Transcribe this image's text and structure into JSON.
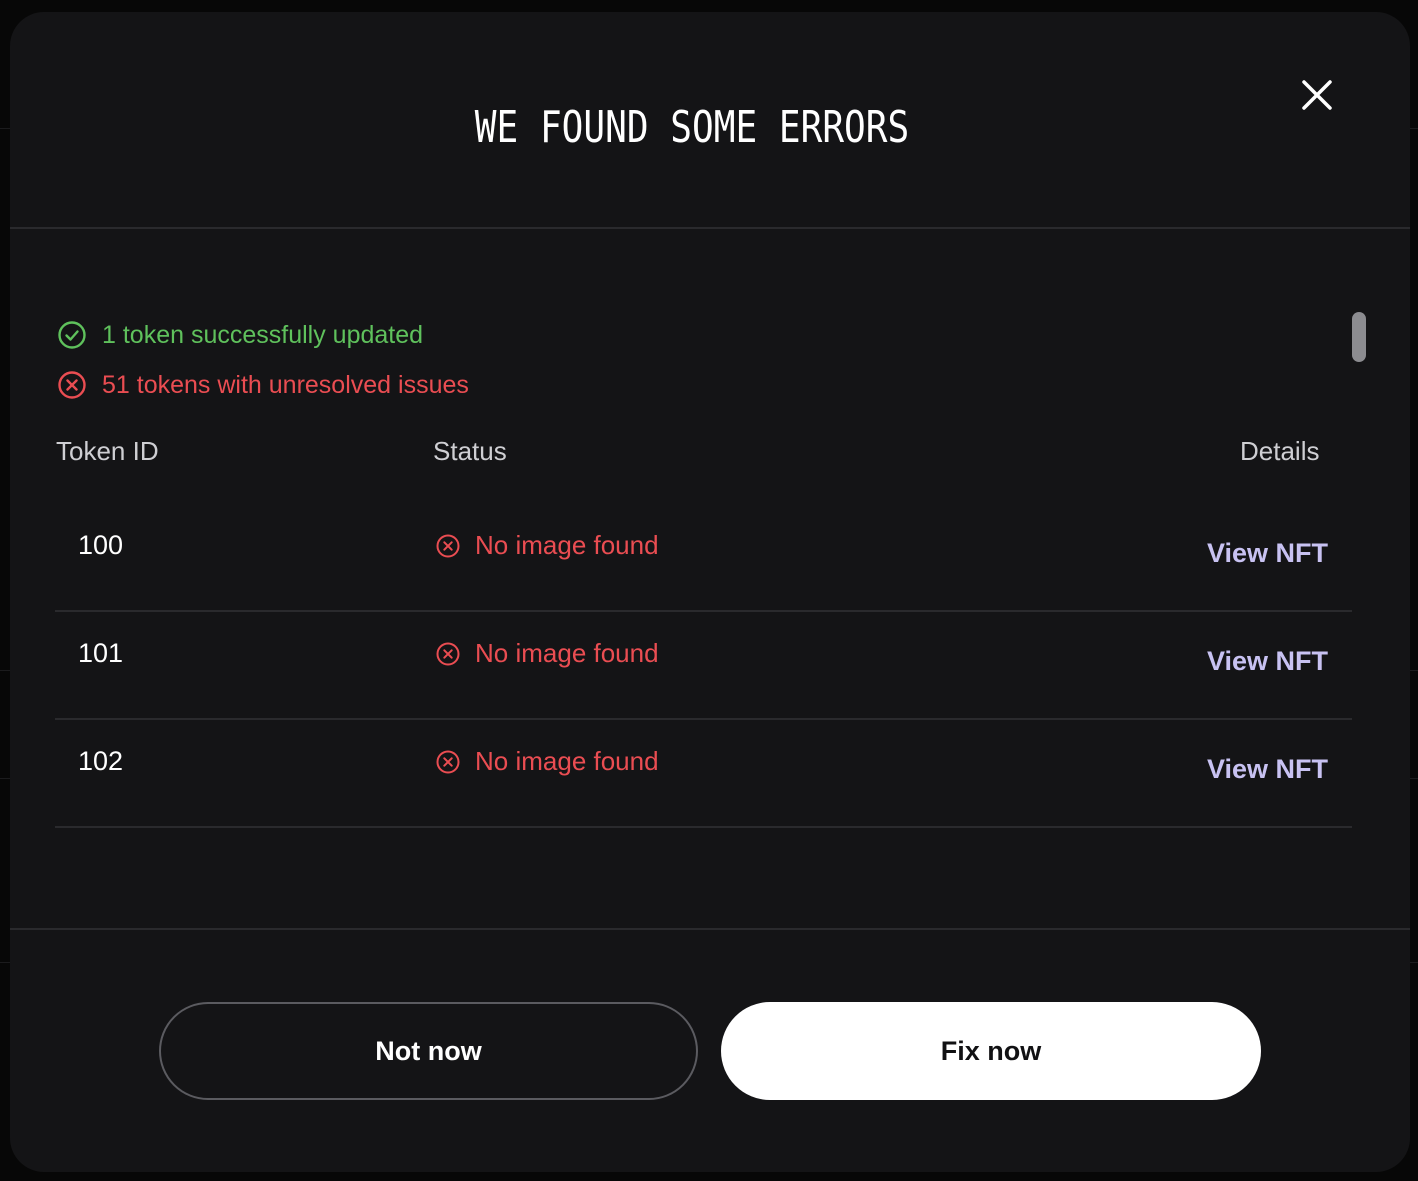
{
  "modal": {
    "title": "WE FOUND SOME ERRORS",
    "close_icon": "close-icon"
  },
  "summary": {
    "success_text": "1 token successfully updated",
    "success_icon": "check-circle-icon",
    "error_text": "51 tokens with unresolved issues",
    "error_icon": "x-circle-icon"
  },
  "table": {
    "columns": [
      "Token ID",
      "Status",
      "Details"
    ],
    "rows": [
      {
        "token_id": "100",
        "status": "No image found",
        "details": "View NFT"
      },
      {
        "token_id": "101",
        "status": "No image found",
        "details": "View NFT"
      },
      {
        "token_id": "102",
        "status": "No image found",
        "details": "View NFT"
      }
    ]
  },
  "actions": {
    "secondary_label": "Not now",
    "primary_label": "Fix now"
  },
  "colors": {
    "success": "#5fc15c",
    "error": "#ea4d52",
    "link": "#c8c2f2",
    "modal_bg": "#141416"
  }
}
